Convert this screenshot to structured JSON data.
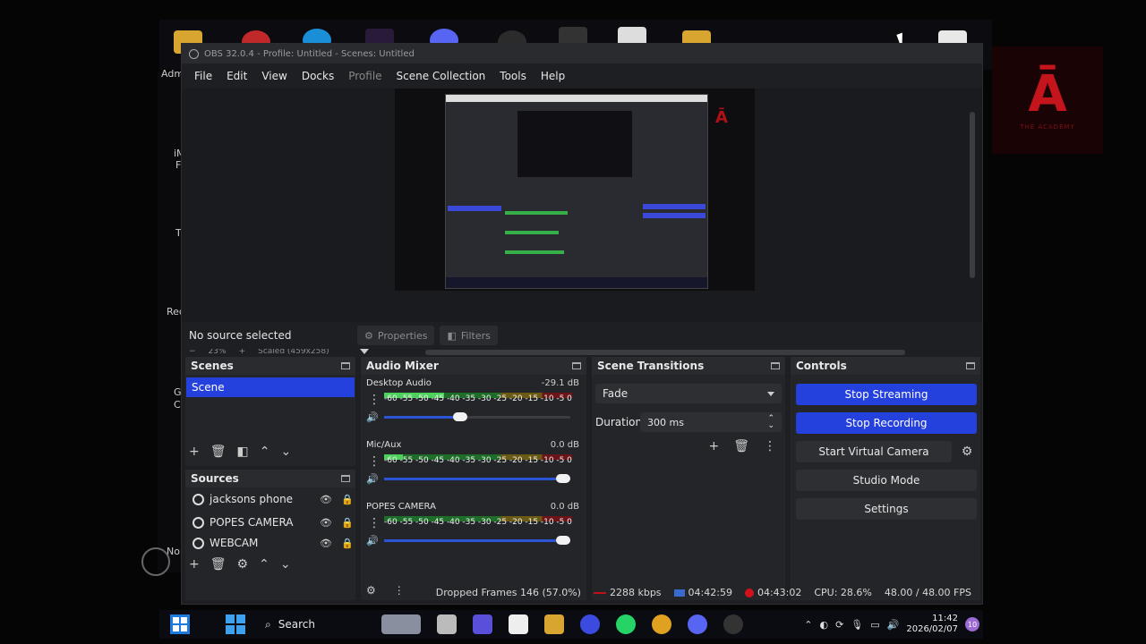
{
  "window": {
    "title": "OBS 32.0.4 - Profile: Untitled - Scenes: Untitled"
  },
  "menu": [
    "File",
    "Edit",
    "View",
    "Docks",
    "Profile",
    "Scene Collection",
    "Tools",
    "Help"
  ],
  "preview": {
    "zoom": "23%",
    "scaled": "Scaled (459x258)"
  },
  "source_bar": {
    "no_source": "No source selected",
    "properties": "Properties",
    "filters": "Filters"
  },
  "scenes": {
    "title": "Scenes",
    "items": [
      "Scene"
    ]
  },
  "sources": {
    "title": "Sources",
    "items": [
      "jacksons phone",
      "POPES CAMERA",
      "WEBCAM"
    ]
  },
  "mixer": {
    "title": "Audio Mixer",
    "scale": [
      "-60",
      "-55",
      "-50",
      "-45",
      "-40",
      "-35",
      "-30",
      "-25",
      "-20",
      "-15",
      "-10",
      "-5",
      "0"
    ],
    "channels": [
      {
        "name": "Desktop Audio",
        "db": "-29.1 dB",
        "level": 0.32,
        "volume": 0.4
      },
      {
        "name": "Mic/Aux",
        "db": "0.0 dB",
        "level": 0.1,
        "volume": 1.0
      },
      {
        "name": "POPES CAMERA",
        "db": "0.0 dB",
        "level": 0.0,
        "volume": 1.0
      }
    ]
  },
  "transitions": {
    "title": "Scene Transitions",
    "selected": "Fade",
    "duration_label": "Duration",
    "duration_value": "300 ms"
  },
  "controls": {
    "title": "Controls",
    "stop_streaming": "Stop Streaming",
    "stop_recording": "Stop Recording",
    "start_virtual_camera": "Start Virtual Camera",
    "studio_mode": "Studio Mode",
    "settings": "Settings"
  },
  "status": {
    "dropped_frames": "Dropped Frames 146 (57.0%)",
    "bitrate": "2288 kbps",
    "stream_time": "04:42:59",
    "record_time": "04:43:02",
    "cpu": "CPU: 28.6%",
    "fps": "48.00 / 48.00 FPS"
  },
  "desktop": {
    "left_labels": [
      "Adm",
      "iM",
      "F",
      "T",
      "Rec",
      "G",
      "C",
      "No"
    ],
    "logo_text": "THE ACADEMY"
  },
  "taskbar": {
    "search": "Search",
    "time": "11:42",
    "date": "2026/02/07",
    "notifications": "10"
  },
  "colors": {
    "accent": "#2440dd",
    "record": "#d0121a"
  }
}
